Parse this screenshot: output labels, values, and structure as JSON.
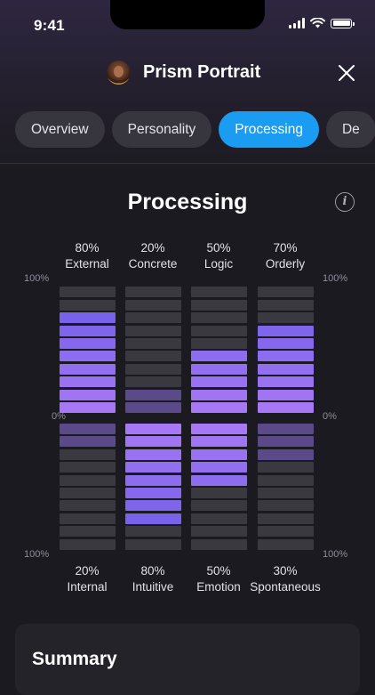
{
  "status_bar": {
    "time": "9:41"
  },
  "header": {
    "title": "Prism Portrait"
  },
  "tabs": [
    {
      "label": "Overview",
      "active": false
    },
    {
      "label": "Personality",
      "active": false
    },
    {
      "label": "Processing",
      "active": true
    },
    {
      "label": "De",
      "active": false
    }
  ],
  "section": {
    "title": "Processing",
    "info_glyph": "i"
  },
  "scale": {
    "top_left": "100%",
    "top_right": "100%",
    "mid_left": "0%",
    "mid_right": "0%",
    "bottom_left": "100%",
    "bottom_right": "100%"
  },
  "columns": [
    {
      "top_percent": "80%",
      "top_label": "External",
      "bottom_percent": "20%",
      "bottom_label": "Internal",
      "top_value": 80,
      "bottom_value": 20,
      "dominant": "top"
    },
    {
      "top_percent": "20%",
      "top_label": "Concrete",
      "bottom_percent": "80%",
      "bottom_label": "Intuitive",
      "top_value": 20,
      "bottom_value": 80,
      "dominant": "bottom"
    },
    {
      "top_percent": "50%",
      "top_label": "Logic",
      "bottom_percent": "50%",
      "bottom_label": "Emotion",
      "top_value": 50,
      "bottom_value": 50,
      "dominant": "both"
    },
    {
      "top_percent": "70%",
      "top_label": "Orderly",
      "bottom_percent": "30%",
      "bottom_label": "Spontaneous",
      "top_value": 70,
      "bottom_value": 30,
      "dominant": "top"
    }
  ],
  "summary": {
    "title": "Summary"
  },
  "colors": {
    "accent": "#1a9cf2",
    "bar_strong_top": "#a678f5",
    "bar_strong_bottom": "#6b5ce8",
    "bar_weak": "#5a4a8a",
    "bar_empty": "#3a393f"
  }
}
